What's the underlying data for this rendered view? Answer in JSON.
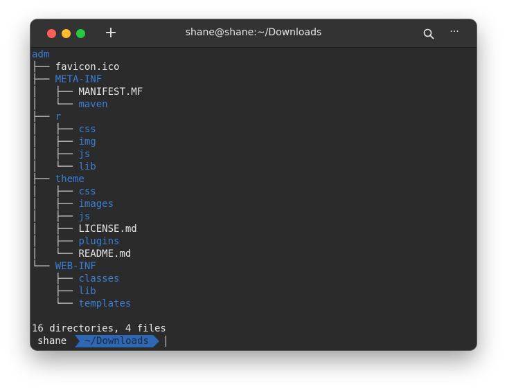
{
  "window": {
    "title": "shane@shane:~/Downloads",
    "new_tab_label": "+",
    "search_icon": "search-icon",
    "more_label": "···"
  },
  "tree": {
    "root": "adm",
    "lines": [
      {
        "prefix": "├── ",
        "name": "favicon.ico",
        "type": "file"
      },
      {
        "prefix": "├── ",
        "name": "META-INF",
        "type": "dir"
      },
      {
        "prefix": "│   ├── ",
        "name": "MANIFEST.MF",
        "type": "file"
      },
      {
        "prefix": "│   └── ",
        "name": "maven",
        "type": "dir"
      },
      {
        "prefix": "├── ",
        "name": "r",
        "type": "dir"
      },
      {
        "prefix": "│   ├── ",
        "name": "css",
        "type": "dir"
      },
      {
        "prefix": "│   ├── ",
        "name": "img",
        "type": "dir"
      },
      {
        "prefix": "│   ├── ",
        "name": "js",
        "type": "dir"
      },
      {
        "prefix": "│   └── ",
        "name": "lib",
        "type": "dir"
      },
      {
        "prefix": "├── ",
        "name": "theme",
        "type": "dir"
      },
      {
        "prefix": "│   ├── ",
        "name": "css",
        "type": "dir"
      },
      {
        "prefix": "│   ├── ",
        "name": "images",
        "type": "dir"
      },
      {
        "prefix": "│   ├── ",
        "name": "js",
        "type": "dir"
      },
      {
        "prefix": "│   ├── ",
        "name": "LICENSE.md",
        "type": "file"
      },
      {
        "prefix": "│   ├── ",
        "name": "plugins",
        "type": "dir"
      },
      {
        "prefix": "│   └── ",
        "name": "README.md",
        "type": "file"
      },
      {
        "prefix": "└── ",
        "name": "WEB-INF",
        "type": "dir"
      },
      {
        "prefix": "    ├── ",
        "name": "classes",
        "type": "dir"
      },
      {
        "prefix": "    ├── ",
        "name": "lib",
        "type": "dir"
      },
      {
        "prefix": "    └── ",
        "name": "templates",
        "type": "dir"
      }
    ],
    "summary": "16 directories, 4 files"
  },
  "prompt": {
    "user": "shane",
    "path": "~/Downloads"
  },
  "colors": {
    "directory": "#3a7fd5",
    "prompt_path_bg": "#2f67b2",
    "terminal_bg": "#2b2b2b"
  }
}
